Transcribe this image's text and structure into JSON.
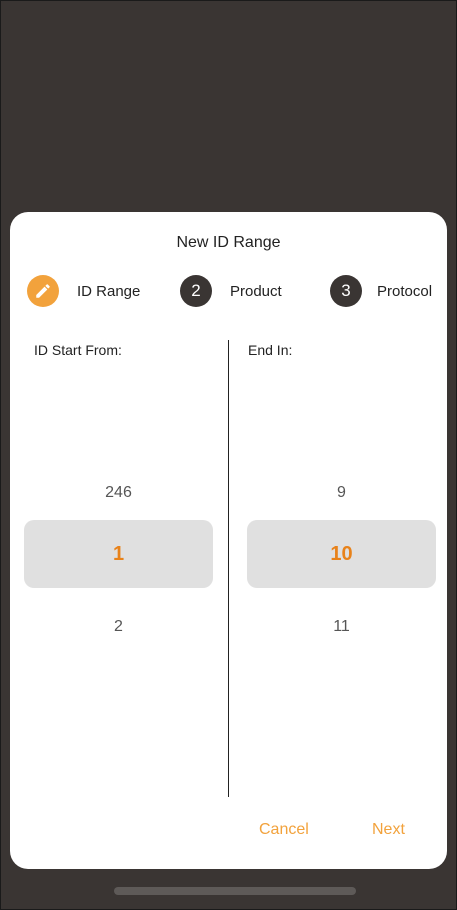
{
  "dialog": {
    "title": "New ID Range",
    "steps": [
      {
        "indicator": "pencil-icon",
        "label": "ID Range",
        "state": "active"
      },
      {
        "number": "2",
        "label": "Product",
        "state": "pending"
      },
      {
        "number": "3",
        "label": "Protocol",
        "state": "pending"
      }
    ],
    "start": {
      "label": "ID Start From:",
      "prev": "246",
      "selected": "1",
      "next": "2"
    },
    "end": {
      "label": "End In:",
      "prev": "9",
      "selected": "10",
      "next": "11"
    },
    "actions": {
      "cancel": "Cancel",
      "next": "Next"
    }
  },
  "colors": {
    "accent": "#f2a23c",
    "selected_text": "#e8821a",
    "backdrop": "#3a3533",
    "pending_step": "#3a3533"
  }
}
